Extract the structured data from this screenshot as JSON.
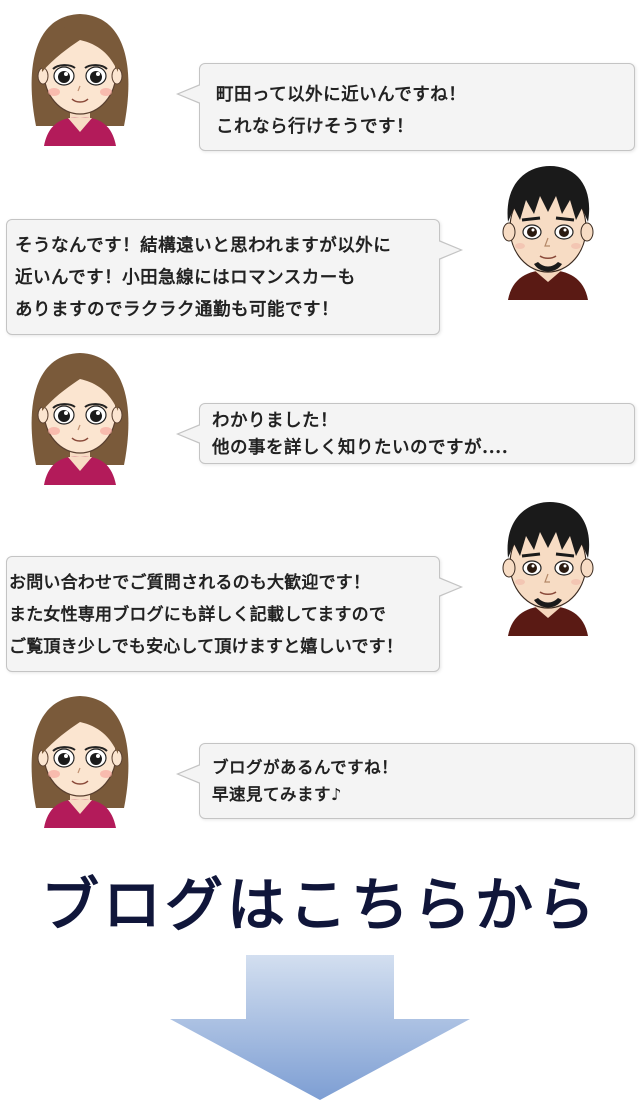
{
  "conversation": [
    {
      "speaker": "woman",
      "lines": [
        "町田って以外に近いんですね！",
        "これなら行けそうです！"
      ]
    },
    {
      "speaker": "man",
      "lines": [
        "そうなんです！結構遠いと思われますが以外に",
        "近いんです！小田急線にはロマンスカーも",
        "ありますのでラクラク通勤も可能です！"
      ]
    },
    {
      "speaker": "woman",
      "lines": [
        "わかりました！",
        "他の事を詳しく知りたいのですが...."
      ]
    },
    {
      "speaker": "man",
      "lines": [
        "お問い合わせでご質問されるのも大歓迎です！",
        "また女性専用ブログにも詳しく記載してますので",
        "ご覧頂き少しでも安心して頂けますと嬉しいです！"
      ]
    },
    {
      "speaker": "woman",
      "lines": [
        "ブログがあるんですね！",
        "早速見てみます♪"
      ]
    }
  ],
  "cta": {
    "heading": "ブログはこちらから",
    "arrow_icon": "down-arrow-icon"
  },
  "colors": {
    "bubble_bg": "#f4f4f4",
    "bubble_border": "#c4c4c4",
    "heading": "#10163a",
    "arrow_top": "#cfdcee",
    "arrow_bottom": "#7f9fd2"
  }
}
